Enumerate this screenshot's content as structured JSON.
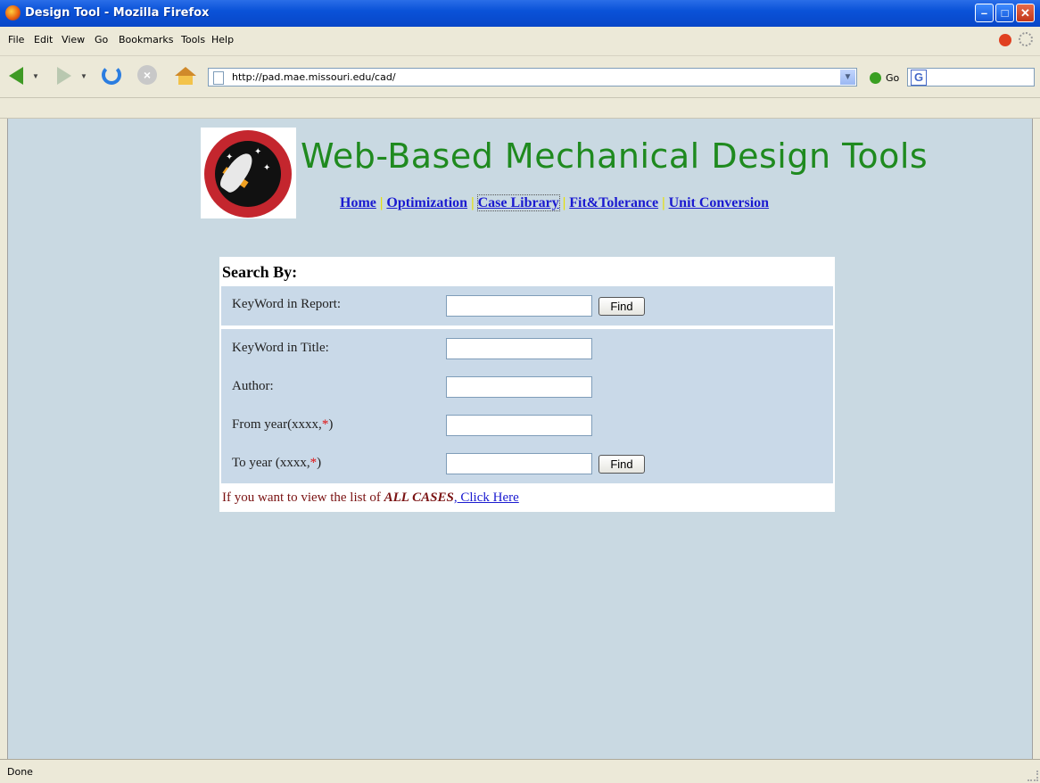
{
  "window": {
    "title": "Design Tool - Mozilla Firefox"
  },
  "menu": {
    "items": [
      "File",
      "Edit",
      "View",
      "Go",
      "Bookmarks",
      "Tools",
      "Help"
    ]
  },
  "toolbar": {
    "url": "http://pad.mae.missouri.edu/cad/",
    "go_label": "Go",
    "search_value": ""
  },
  "status": {
    "text": "Done"
  },
  "page": {
    "heading": "Web-Based Mechanical Design Tools",
    "nav": [
      "Home",
      "Optimization",
      "Case Library",
      "Fit&Tolerance",
      "Unit Conversion"
    ],
    "search": {
      "title": "Search By:",
      "keyword_report_label": "KeyWord in Report:",
      "keyword_title_label": "KeyWord in Title:",
      "author_label": "Author:",
      "from_year_label": "From year(xxxx,",
      "to_year_label": "To year  (xxxx,",
      "required_mark": "*",
      "label_close": ")",
      "find_label": "Find",
      "all_prefix": "If you want to view the list of ",
      "all_emph": "ALL CASES",
      "all_sep": ",",
      "all_link": " Click Here"
    }
  }
}
